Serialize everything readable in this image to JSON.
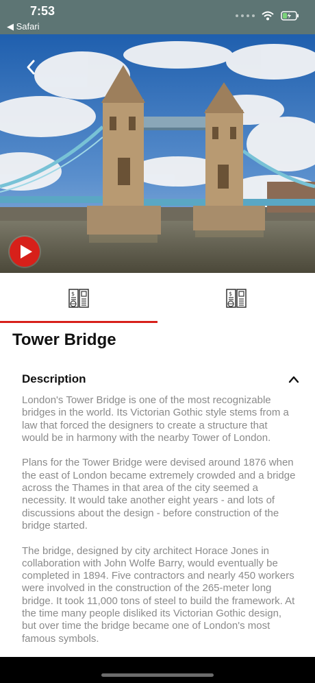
{
  "status_bar": {
    "time": "7:53",
    "back_app": "◀ Safari",
    "battery_color": "#7cd37a"
  },
  "hero": {
    "image_subject": "Tower Bridge photo over the Thames",
    "back_icon": "chevron-left-icon",
    "play_icon": "play-icon",
    "accent_color": "#d7201a"
  },
  "tabs": [
    {
      "icon": "document-money-globe-icon",
      "active": true
    },
    {
      "icon": "document-money-globe-icon",
      "active": false
    }
  ],
  "page": {
    "title": "Tower Bridge"
  },
  "description": {
    "header": "Description",
    "paragraphs": [
      "London's Tower Bridge is one of the most recognizable bridges in the world. Its Victorian Gothic style stems from a law that forced the designers to create a structure that would be in harmony with the nearby Tower of London.",
      "Plans for the Tower Bridge were devised around 1876 when the east of London became extremely crowded and a bridge across the Thames in that area of the city seemed a necessity. It would take another eight years - and lots of discussions about the design - before construction of the bridge started.",
      "The bridge, designed by city architect Horace Jones in collaboration with John Wolfe Barry, would eventually be completed in 1894. Five contractors and nearly 450 workers were involved in the construction of the 265-meter long bridge. It took 11,000 tons of steel to build the framework. At the time many people disliked its Victorian Gothic design, but over time the bridge became one of London's most famous symbols."
    ]
  }
}
